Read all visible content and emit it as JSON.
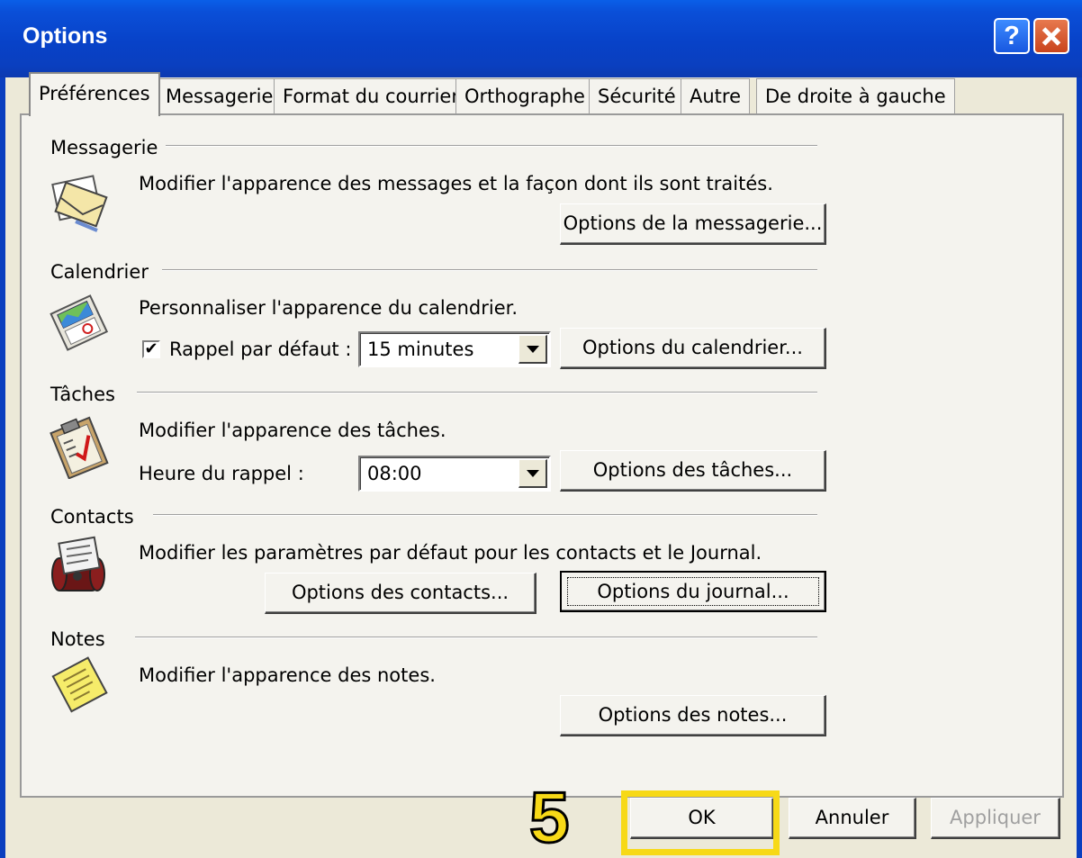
{
  "window": {
    "title": "Options",
    "help_label": "?"
  },
  "tabs": [
    {
      "label": "Préférences"
    },
    {
      "label": "Messagerie"
    },
    {
      "label": "Format du courrier"
    },
    {
      "label": "Orthographe"
    },
    {
      "label": "Sécurité"
    },
    {
      "label": "Autre"
    },
    {
      "label": "De droite à gauche"
    }
  ],
  "messagerie": {
    "heading": "Messagerie",
    "description": "Modifier l'apparence des messages et la façon dont ils sont traités.",
    "button": "Options de la messagerie..."
  },
  "calendrier": {
    "heading": "Calendrier",
    "description": "Personnaliser l'apparence du calendrier.",
    "reminder_label": "Rappel par défaut :",
    "reminder_checked": "✔",
    "reminder_value": "15 minutes",
    "button": "Options du calendrier..."
  },
  "taches": {
    "heading": "Tâches",
    "description": "Modifier l'apparence des tâches.",
    "reminder_time_label": "Heure du rappel :",
    "reminder_time_value": "08:00",
    "button": "Options des tâches..."
  },
  "contacts": {
    "heading": "Contacts",
    "description": "Modifier les paramètres par défaut pour les contacts et le Journal.",
    "contacts_button": "Options des contacts...",
    "journal_button": "Options du journal..."
  },
  "notes": {
    "heading": "Notes",
    "description": "Modifier l'apparence des notes.",
    "button": "Options des notes..."
  },
  "footer": {
    "ok": "OK",
    "cancel": "Annuler",
    "apply": "Appliquer"
  },
  "annotation": {
    "step_number": "5",
    "highlight_color": "#F7D917"
  }
}
